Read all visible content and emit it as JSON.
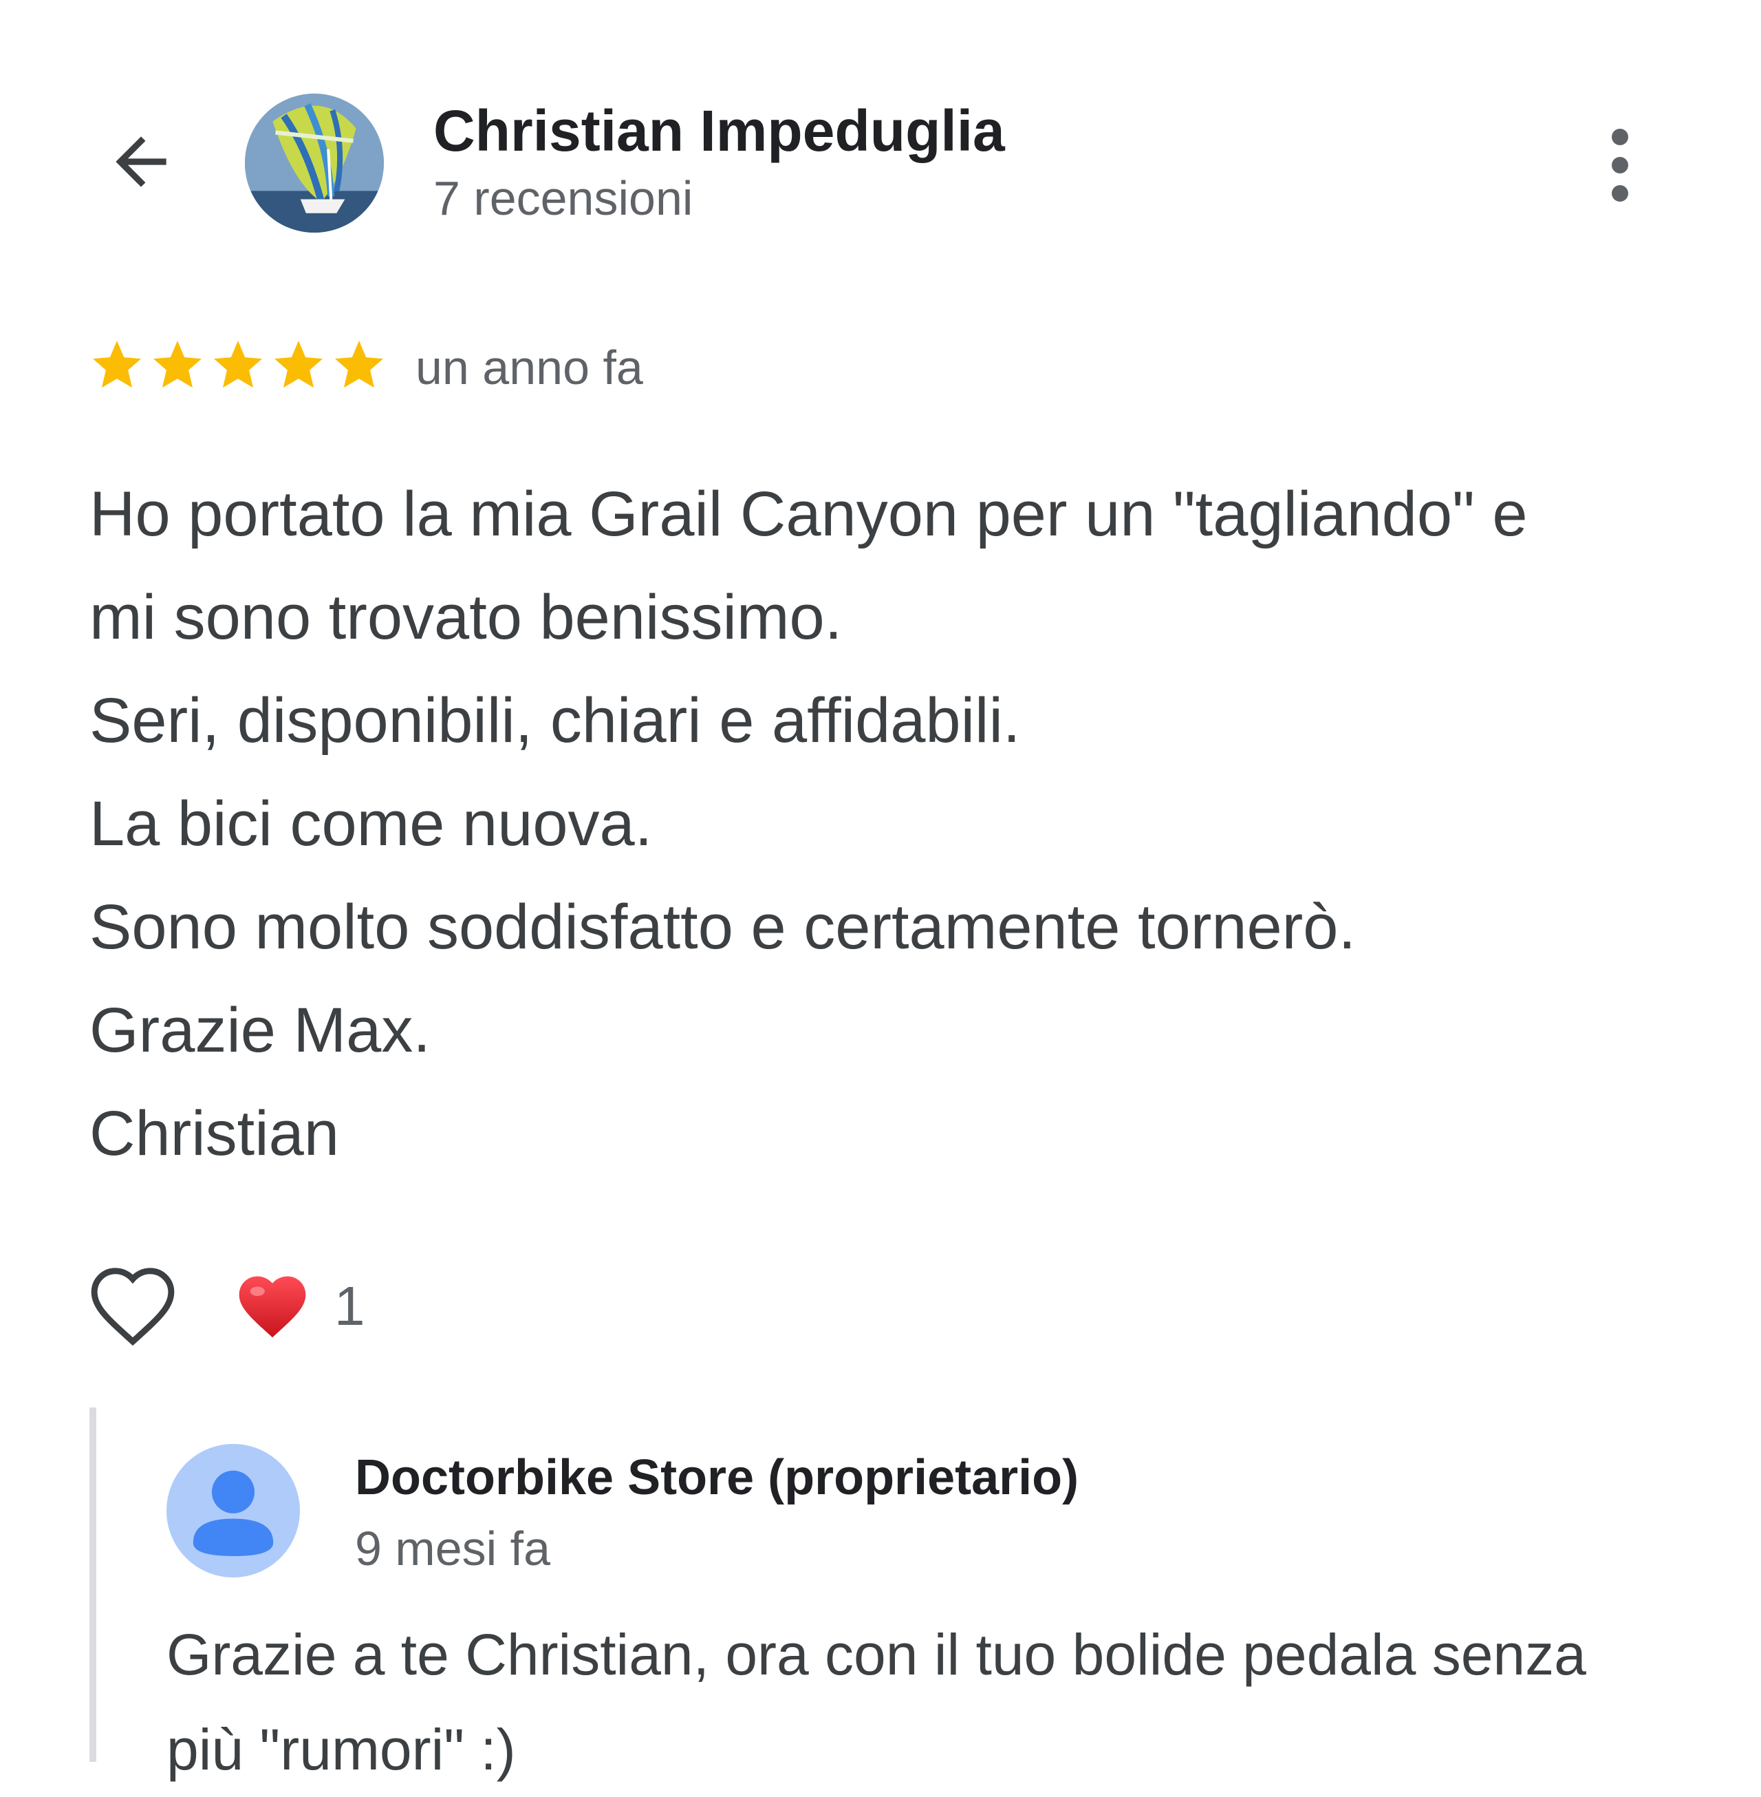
{
  "header": {
    "reviewer_name": "Christian Impeduglia",
    "review_count": "7 recensioni",
    "back_icon": "arrow-left-icon",
    "more_icon": "more-vert-icon"
  },
  "review": {
    "rating": 5,
    "rating_max": 5,
    "time": "un anno fa",
    "lines": [
      "Ho portato la mia Grail Canyon per un \"tagliando\" e",
      "mi sono trovato benissimo.",
      "Seri, disponibili, chiari e affidabili.",
      "La bici come nuova.",
      "Sono molto soddisfatto e certamente tornerò.",
      "Grazie Max.",
      "Christian"
    ]
  },
  "reactions": {
    "like_icon": "heart-outline-icon",
    "reaction_icon": "red-heart-icon",
    "count": "1"
  },
  "owner_reply": {
    "name": "Doctorbike Store (proprietario)",
    "time": "9 mesi fa",
    "lines": [
      "Grazie a te Christian, ora con il tuo bolide pedala senza",
      "più \"rumori\" :)"
    ]
  },
  "colors": {
    "star": "#fbbc04",
    "text": "#3c4043",
    "secondary": "#5f6368",
    "owner_avatar_bg": "#aecbfa",
    "owner_avatar_fg": "#4285f4",
    "heart": "#e0282e"
  }
}
